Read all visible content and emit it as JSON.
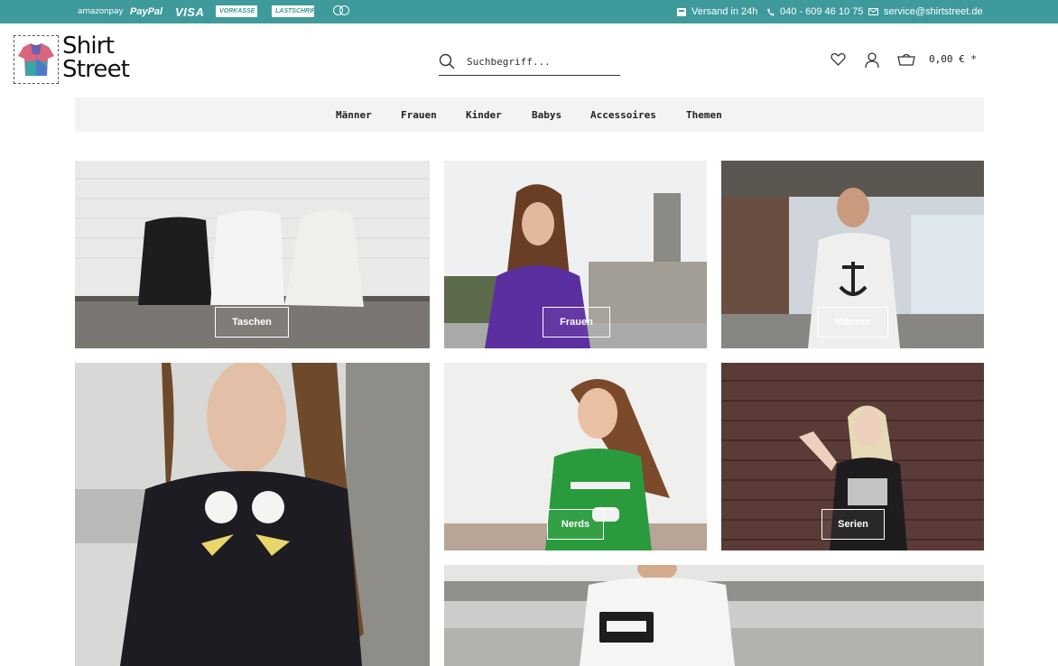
{
  "topbar": {
    "payments": {
      "amazon": "amazonpay",
      "paypal": "PayPal",
      "visa": "VISA",
      "vorkasse": "VORKASSE",
      "lastschrift": "LASTSCHRIFT"
    },
    "shipping": "Versand in 24h",
    "phone": "040 - 609 46 10 75",
    "email": "service@shirtstreet.de"
  },
  "header": {
    "logo_line1": "Shirt",
    "logo_line2": "Street",
    "search_placeholder": "Suchbegriff...",
    "cart_total": "0,00 € *"
  },
  "nav": {
    "items": [
      "Männer",
      "Frauen",
      "Kinder",
      "Babys",
      "Accessoires",
      "Themen"
    ]
  },
  "tiles": {
    "taschen": "Taschen",
    "frauen": "Frauen",
    "maenner": "Männer",
    "nerds": "Nerds",
    "serien": "Serien"
  },
  "colors": {
    "topbar": "#3f9a9c",
    "nav_bg": "#f3f3f3"
  }
}
